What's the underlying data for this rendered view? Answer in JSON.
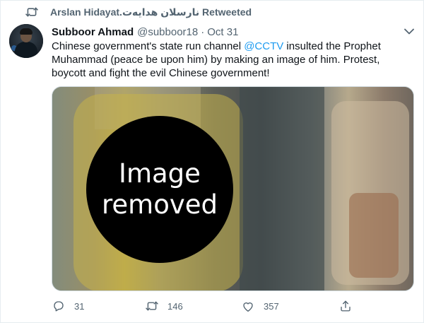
{
  "retweet_banner": {
    "text": "Arslan Hidayat.نارسلان ھدایەت Retweeted",
    "icon": "retweet-icon"
  },
  "tweet": {
    "author_name": "Subboor Ahmad",
    "handle": "@subboor18",
    "separator": "·",
    "date": "Oct 31",
    "text_before_mention": "Chinese government's state run channel ",
    "mention": "@CCTV",
    "text_after_mention": " insulted the Prophet Muhammad (peace be upon him) by making an image of him. Protest, boycott and fight the evil Chinese government!"
  },
  "media": {
    "overlay_line1": "Image",
    "overlay_line2": "removed"
  },
  "actions": {
    "reply_count": "31",
    "retweet_count": "146",
    "like_count": "357"
  },
  "colors": {
    "link": "#1d9bf0",
    "secondary_text": "#536471",
    "primary_text": "#0f1419",
    "retweet_green": "#536471"
  }
}
